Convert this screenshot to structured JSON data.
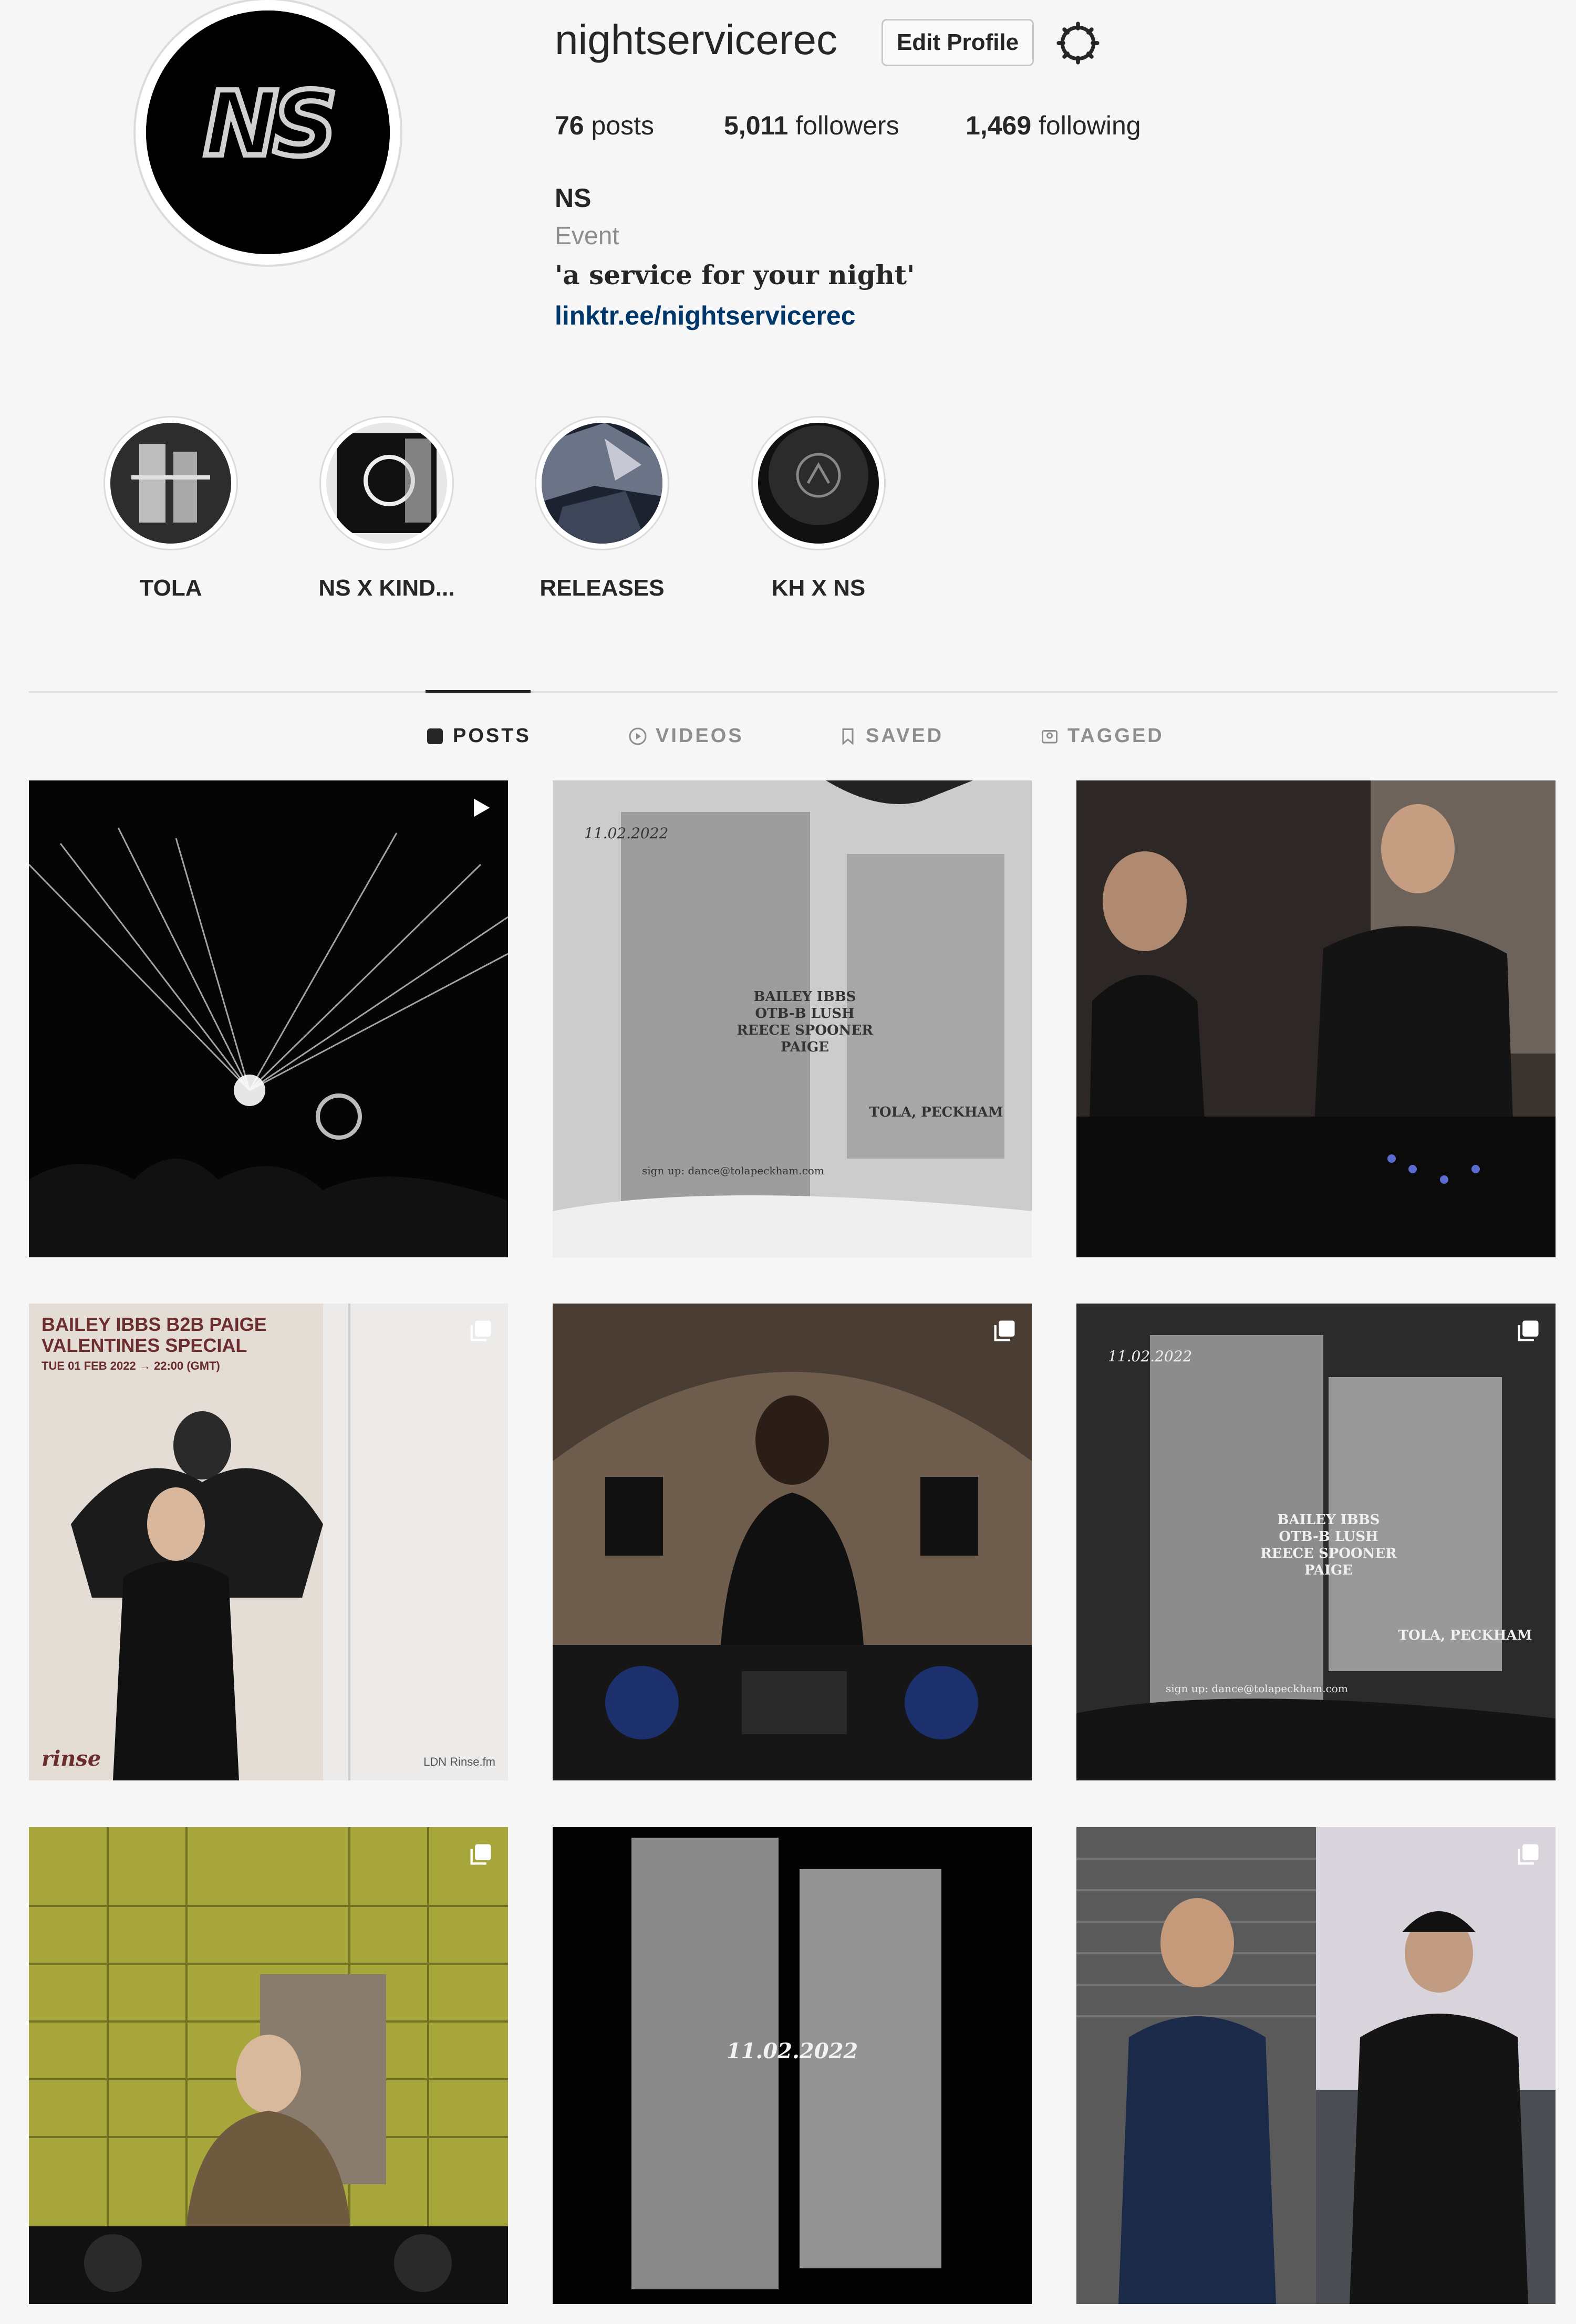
{
  "profile": {
    "username": "nightservicerec",
    "edit_profile_label": "Edit Profile",
    "avatar_text": "NS",
    "stats": {
      "posts_count": "76",
      "posts_label": "posts",
      "followers_count": "5,011",
      "followers_label": "followers",
      "following_count": "1,469",
      "following_label": "following"
    },
    "bio": {
      "name": "NS",
      "category": "Event",
      "text": "'a service for your night'",
      "link": "linktr.ee/nightservicerec"
    }
  },
  "highlights": [
    {
      "label": "TOLA"
    },
    {
      "label": "NS X KIND..."
    },
    {
      "label": "RELEASES"
    },
    {
      "label": "KH X NS"
    }
  ],
  "tabs": [
    {
      "label": "POSTS",
      "icon": "grid-icon",
      "active": true
    },
    {
      "label": "VIDEOS",
      "icon": "play-circle-icon",
      "active": false
    },
    {
      "label": "SAVED",
      "icon": "bookmark-icon",
      "active": false
    },
    {
      "label": "TAGGED",
      "icon": "tag-icon",
      "active": false
    }
  ],
  "posts": [
    {
      "description": "laser-show",
      "badge": "reel-icon"
    },
    {
      "description": "tola-flyer-light",
      "flyer": {
        "date": "11.02.2022",
        "lineup": [
          "BAILEY IBBS",
          "OTB-B LUSH",
          "REECE SPOONER",
          "PAIGE"
        ],
        "venue": "TOLA, PECKHAM",
        "footer": "sign up: dance@tolapeckham.com"
      },
      "badge": null
    },
    {
      "description": "djs-at-decks",
      "badge": null
    },
    {
      "description": "rinse-fm-poster",
      "poster": {
        "title_line1": "BAILEY IBBS B2B PAIGE",
        "title_line2": "VALENTINES SPECIAL",
        "datetime": "TUE 01 FEB 2022 → 22:00 (GMT)",
        "brand": "rinse",
        "station": "LDN  Rinse.fm"
      },
      "badge": "carousel-icon"
    },
    {
      "description": "dj-brick-arch",
      "badge": "carousel-icon"
    },
    {
      "description": "tola-flyer-dark",
      "flyer": {
        "date": "11.02.2022",
        "lineup": [
          "BAILEY IBBS",
          "OTB-B LUSH",
          "REECE SPOONER",
          "PAIGE"
        ],
        "venue": "TOLA, PECKHAM",
        "footer": "sign up: dance@tolapeckham.com"
      },
      "badge": "carousel-icon"
    },
    {
      "description": "dj-yellow-tiles",
      "badge": "carousel-icon"
    },
    {
      "description": "tola-tape-black",
      "flyer": {
        "date": "11.02.2022"
      },
      "badge": null
    },
    {
      "description": "two-portraits",
      "badge": "carousel-icon"
    }
  ],
  "colors": {
    "background": "#f6f6f6",
    "text": "#262626",
    "muted": "#8e8e8e",
    "link": "#00376b"
  }
}
